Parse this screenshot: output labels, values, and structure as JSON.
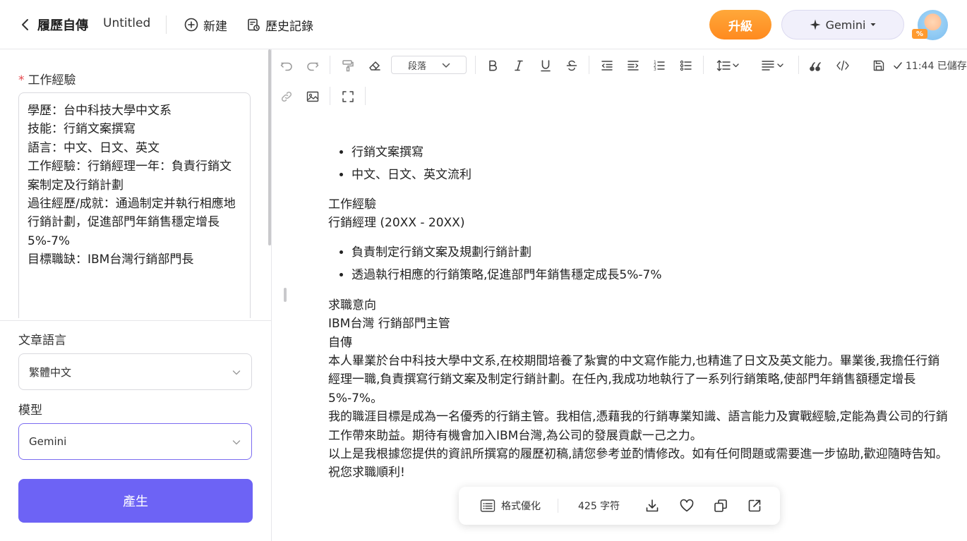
{
  "header": {
    "app_title": "履歷自傳",
    "doc_title": "Untitled",
    "new_label": "新建",
    "history_label": "歷史記錄",
    "upgrade_label": "升級",
    "model_label": "Gemini",
    "avatar_badge": "%"
  },
  "left_panel": {
    "work_label": "工作經驗",
    "work_value": "學歷：台中科技大學中文系\n技能：行銷文案撰寫\n語言：中文、日文、英文\n工作經驗：行銷經理一年：負責行銷文案制定及行銷計劃\n過往經歷/成就：通過制定并執行相應地行銷計劃，促進部門年銷售穩定增長5%-7%\n目標職缺：IBM台灣行銷部門長",
    "language_label": "文章語言",
    "language_value": "繁體中文",
    "model_label": "模型",
    "model_value": "Gemini",
    "generate_label": "產生"
  },
  "toolbar": {
    "paragraph_label": "段落",
    "saved_time": "11:44 已儲存"
  },
  "document": {
    "bullets_1": [
      "行銷文案撰寫",
      "中文、日文、英文流利"
    ],
    "work_heading": "工作經驗",
    "work_role": "行銷經理 (20XX - 20XX)",
    "bullets_2": [
      "負責制定行銷文案及規劃行銷計劃",
      "透過執行相應的行銷策略,促進部門年銷售穩定成長5%-7%"
    ],
    "objective_heading": "求職意向",
    "objective_value": "IBM台灣 行銷部門主管",
    "bio_heading": "自傳",
    "bio_p1": "本人畢業於台中科技大學中文系,在校期間培養了紮實的中文寫作能力,也精進了日文及英文能力。畢業後,我擔任行銷經理一職,負責撰寫行銷文案及制定行銷計劃。在任內,我成功地執行了一系列行銷策略,使部門年銷售額穩定增長5%-7%。",
    "bio_p2": "我的職涯目標是成為一名優秀的行銷主管。我相信,憑藉我的行銷專業知識、語言能力及實戰經驗,定能為貴公司的行銷工作帶來助益。期待有機會加入IBM台灣,為公司的發展貢獻一己之力。",
    "bio_p3": "以上是我根據您提供的資訊所撰寫的履歷初稿,請您參考並酌情修改。如有任何問題或需要進一步協助,歡迎隨時告知。祝您求職順利!"
  },
  "floatbar": {
    "format_label": "格式優化",
    "char_count": "425 字符"
  },
  "colors": {
    "accent": "#6d63f5",
    "upgrade": "#ff8a1f",
    "required": "#e5484d"
  }
}
